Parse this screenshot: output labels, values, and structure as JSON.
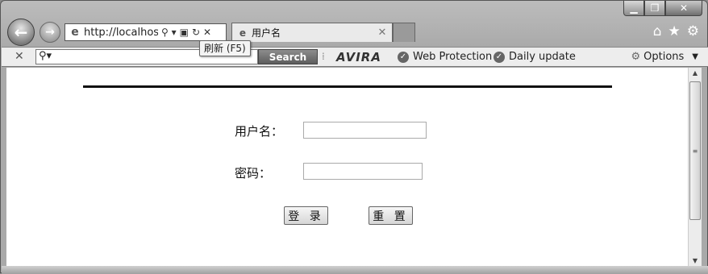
{
  "browser": {
    "address_url": "http://localhost/",
    "tab_title": "用户名",
    "tooltip": "刷新 (F5)",
    "icons": {
      "back": "arrow-left-icon",
      "forward": "arrow-right-icon",
      "search": "search-icon",
      "refresh": "refresh-icon",
      "stop": "close-icon",
      "home": "home-icon",
      "favorites": "star-icon",
      "tools": "gear-icon"
    }
  },
  "toolbar": {
    "search_button": "Search",
    "avira": "AVIRA",
    "web_protection": "Web Protection",
    "daily_update": "Daily update",
    "options": "Options"
  },
  "form": {
    "username_label": "用户名：",
    "password_label": "密码：",
    "login_button": "登 录",
    "reset_button": "重 置",
    "username_value": "",
    "password_value": ""
  }
}
